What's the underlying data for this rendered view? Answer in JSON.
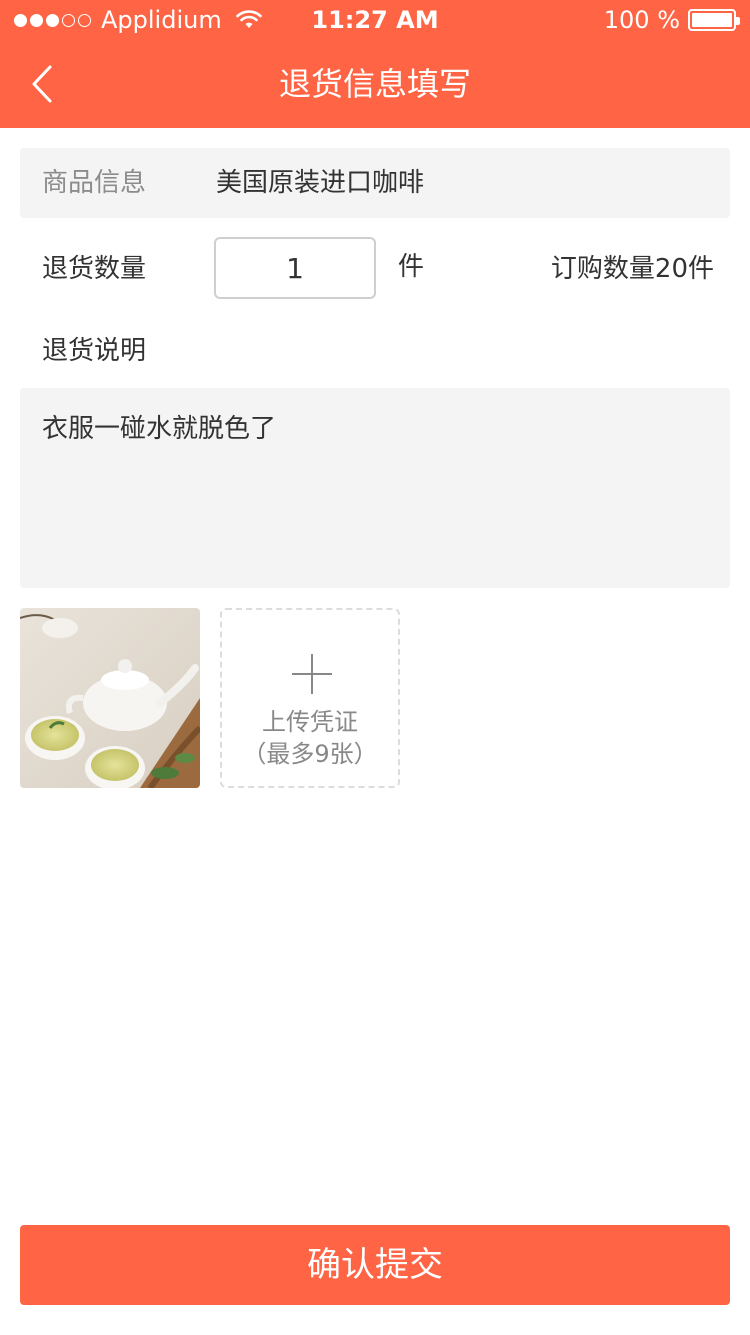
{
  "status_bar": {
    "carrier": "Applidium",
    "time": "11:27 AM",
    "battery": "100 %"
  },
  "nav": {
    "title": "退货信息填写",
    "back_icon": "chevron-left-icon"
  },
  "product": {
    "label": "商品信息",
    "value": "美国原装进口咖啡"
  },
  "quantity": {
    "label": "退货数量",
    "value": "1",
    "unit": "件",
    "order_quantity": "订购数量20件"
  },
  "description": {
    "label": "退货说明",
    "value": "衣服一碰水就脱色了"
  },
  "upload": {
    "label": "上传凭证",
    "hint": "（最多9张）",
    "icon": "plus-icon"
  },
  "submit": {
    "label": "确认提交"
  },
  "colors": {
    "accent": "#ff6444",
    "panel": "#f4f4f4"
  }
}
